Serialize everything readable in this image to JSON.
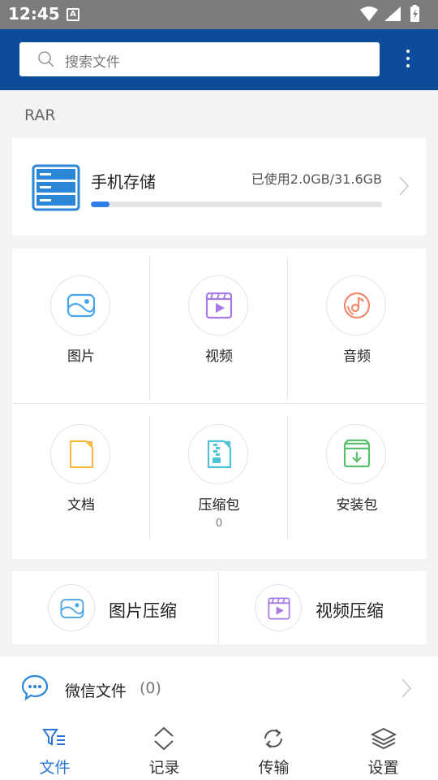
{
  "status_bar": {
    "time": "12:45",
    "notification_icon": "A"
  },
  "header": {
    "search_placeholder": "搜索文件",
    "menu_icon": "more-vertical-icon",
    "bg_color": "#0d4b9b"
  },
  "section_label": "RAR",
  "storage": {
    "title": "手机存储",
    "used_text": "已使用2.0GB/31.6GB",
    "used_fraction": 0.063,
    "bar_color": "#2f7ee8"
  },
  "categories": [
    {
      "label": "图片",
      "icon": "image-icon",
      "color": "#4aa6e8"
    },
    {
      "label": "视频",
      "icon": "video-icon",
      "color": "#a77be6"
    },
    {
      "label": "音频",
      "icon": "audio-icon",
      "color": "#f08a6a"
    },
    {
      "label": "文档",
      "icon": "document-icon",
      "color": "#f5b945"
    },
    {
      "label": "压缩包",
      "icon": "zip-icon",
      "color": "#4cc3d6",
      "count": "0"
    },
    {
      "label": "安装包",
      "icon": "apk-icon",
      "color": "#5bbf6b"
    }
  ],
  "compress": [
    {
      "label": "图片压缩",
      "icon": "image-compress-icon"
    },
    {
      "label": "视频压缩",
      "icon": "video-compress-icon"
    }
  ],
  "wechat": {
    "label": "微信文件",
    "count": "(0)",
    "icon": "wechat-chat-icon"
  },
  "nav": [
    {
      "label": "文件",
      "icon": "file-filter-icon",
      "active": true
    },
    {
      "label": "记录",
      "icon": "updown-icon",
      "active": false
    },
    {
      "label": "传输",
      "icon": "sync-icon",
      "active": false
    },
    {
      "label": "设置",
      "icon": "layers-icon",
      "active": false
    }
  ],
  "accent_color": "#2a74d8"
}
